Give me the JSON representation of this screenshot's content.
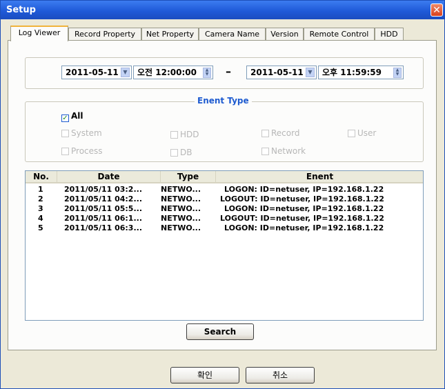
{
  "window": {
    "title": "Setup",
    "close_glyph": "✕"
  },
  "tabs": [
    {
      "label": "Log Viewer",
      "active": true
    },
    {
      "label": "Record Property",
      "active": false
    },
    {
      "label": "Net Property",
      "active": false
    },
    {
      "label": "Camera Name",
      "active": false
    },
    {
      "label": "Version",
      "active": false
    },
    {
      "label": "Remote Control",
      "active": false
    },
    {
      "label": "HDD",
      "active": false
    }
  ],
  "range": {
    "start_date": "2011-05-11",
    "start_time": "오전 12:00:00",
    "separator": "–",
    "end_date": "2011-05-11",
    "end_time": "오후 11:59:59",
    "dropdown_glyph": "▼",
    "spin_up": "▲",
    "spin_down": "▼"
  },
  "event_type": {
    "legend": "Enent Type",
    "check_glyph": "✓",
    "all": {
      "label": "All",
      "checked": true
    },
    "options": [
      {
        "label": "System",
        "checked": false
      },
      {
        "label": "HDD",
        "checked": false
      },
      {
        "label": "Record",
        "checked": false
      },
      {
        "label": "User",
        "checked": false
      },
      {
        "label": "Process",
        "checked": false
      },
      {
        "label": "DB",
        "checked": false
      },
      {
        "label": "Network",
        "checked": false
      }
    ]
  },
  "log_table": {
    "columns": [
      "No.",
      "Date",
      "Type",
      "Enent"
    ],
    "rows": [
      {
        "no": "1",
        "date": "2011/05/11 03:2...",
        "type": "NETWO...",
        "event": "LOGON: ID=netuser, IP=192.168.1.22"
      },
      {
        "no": "2",
        "date": "2011/05/11 04:2...",
        "type": "NETWO...",
        "event": "LOGOUT: ID=netuser, IP=192.168.1.22"
      },
      {
        "no": "3",
        "date": "2011/05/11 05:5...",
        "type": "NETWO...",
        "event": "LOGON: ID=netuser, IP=192.168.1.22"
      },
      {
        "no": "4",
        "date": "2011/05/11 06:1...",
        "type": "NETWO...",
        "event": "LOGOUT: ID=netuser, IP=192.168.1.22"
      },
      {
        "no": "5",
        "date": "2011/05/11 06:3...",
        "type": "NETWO...",
        "event": "LOGON: ID=netuser, IP=192.168.1.22"
      }
    ]
  },
  "buttons": {
    "search": "Search",
    "ok": "확인",
    "cancel": "취소"
  },
  "colors": {
    "title_bar": "#1f5ad8",
    "active_tab_accent": "#f0b33a",
    "legend_text": "#1e5bd0",
    "close_button": "#d8401c"
  }
}
